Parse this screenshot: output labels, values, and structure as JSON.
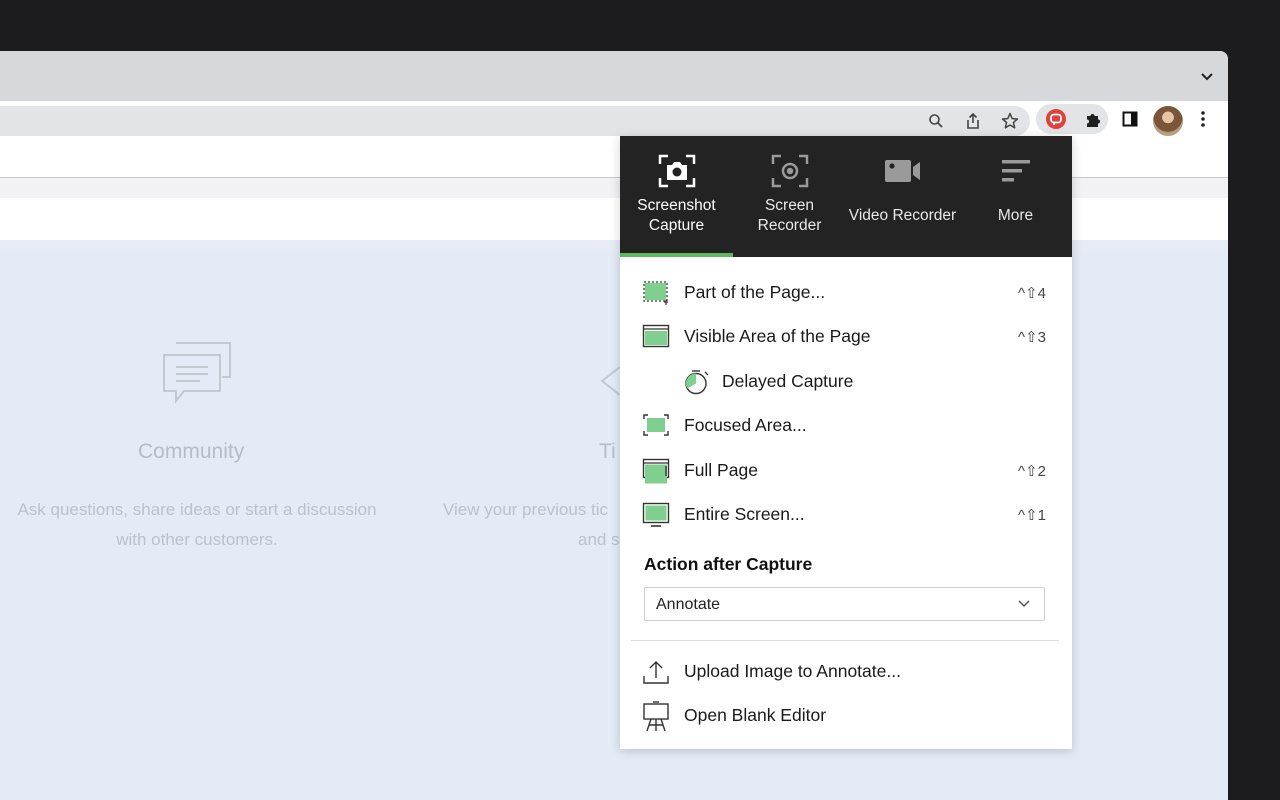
{
  "page": {
    "cards": [
      {
        "title": "Community",
        "desc_line1": "Ask questions, share ideas or start a discussion",
        "desc_line2": "with other customers."
      },
      {
        "title": "Ti",
        "desc_line1": "View your previous tic",
        "desc_line2": "and s"
      }
    ]
  },
  "popup": {
    "tabs": [
      {
        "label": "Screenshot Capture",
        "icon": "camera-icon",
        "active": true
      },
      {
        "label": "Screen Recorder",
        "icon": "screen-record-icon",
        "active": false
      },
      {
        "label": "Video Recorder",
        "icon": "video-camera-icon",
        "active": false
      },
      {
        "label": "More",
        "icon": "menu-lines-icon",
        "active": false
      }
    ],
    "items": [
      {
        "label": "Part of the Page...",
        "shortcut": "^⇧4",
        "icon": "selection-area-icon"
      },
      {
        "label": "Visible Area of the Page",
        "shortcut": "^⇧3",
        "icon": "visible-area-icon"
      },
      {
        "label": "Delayed Capture",
        "shortcut": "",
        "icon": "timer-icon"
      },
      {
        "label": "Focused Area...",
        "shortcut": "",
        "icon": "focused-area-icon"
      },
      {
        "label": "Full Page",
        "shortcut": "^⇧2",
        "icon": "full-page-icon"
      },
      {
        "label": "Entire Screen...",
        "shortcut": "^⇧1",
        "icon": "monitor-icon"
      }
    ],
    "action_title": "Action after Capture",
    "action_value": "Annotate",
    "bottom_items": [
      {
        "label": "Upload Image to Annotate...",
        "icon": "upload-icon"
      },
      {
        "label": "Open Blank Editor",
        "icon": "easel-icon"
      }
    ]
  },
  "colors": {
    "accent_green": "#5fb75f",
    "popup_header": "#232323",
    "page_background": "#e4eaf6"
  }
}
